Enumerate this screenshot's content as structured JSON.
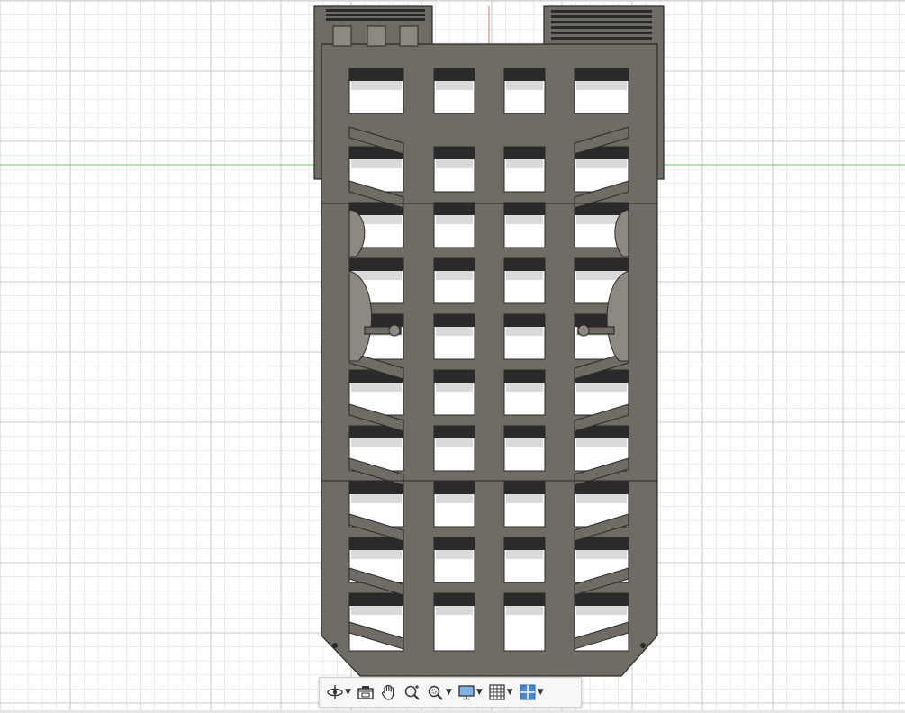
{
  "viewport": {
    "background": "#ffffff",
    "grid_minor_color": "#e2e2e2",
    "grid_major_color": "#c9c9c9",
    "x_axis_color": "#7fd97f",
    "y_axis_color": "#e88080",
    "model_fill": "#6f6b65",
    "model_edge": "#2b2a28",
    "model_highlight": "#8d8982",
    "slot_dark": "#2a2a2a",
    "slot_shade": "#d9d9d9"
  },
  "toolbar": {
    "tools": [
      {
        "name": "orbit",
        "icon": "orbit-icon",
        "has_dropdown": true
      },
      {
        "name": "look-at",
        "icon": "look-at-icon",
        "has_dropdown": false
      },
      {
        "name": "pan",
        "icon": "pan-hand-icon",
        "has_dropdown": false
      },
      {
        "name": "zoom",
        "icon": "zoom-icon",
        "has_dropdown": false
      },
      {
        "name": "fit",
        "icon": "fit-window-icon",
        "has_dropdown": true
      },
      {
        "name": "display-settings",
        "icon": "display-settings-icon",
        "has_dropdown": true
      },
      {
        "name": "grid-snaps",
        "icon": "grid-icon",
        "has_dropdown": true
      },
      {
        "name": "viewports",
        "icon": "viewports-icon",
        "has_dropdown": true
      }
    ]
  }
}
